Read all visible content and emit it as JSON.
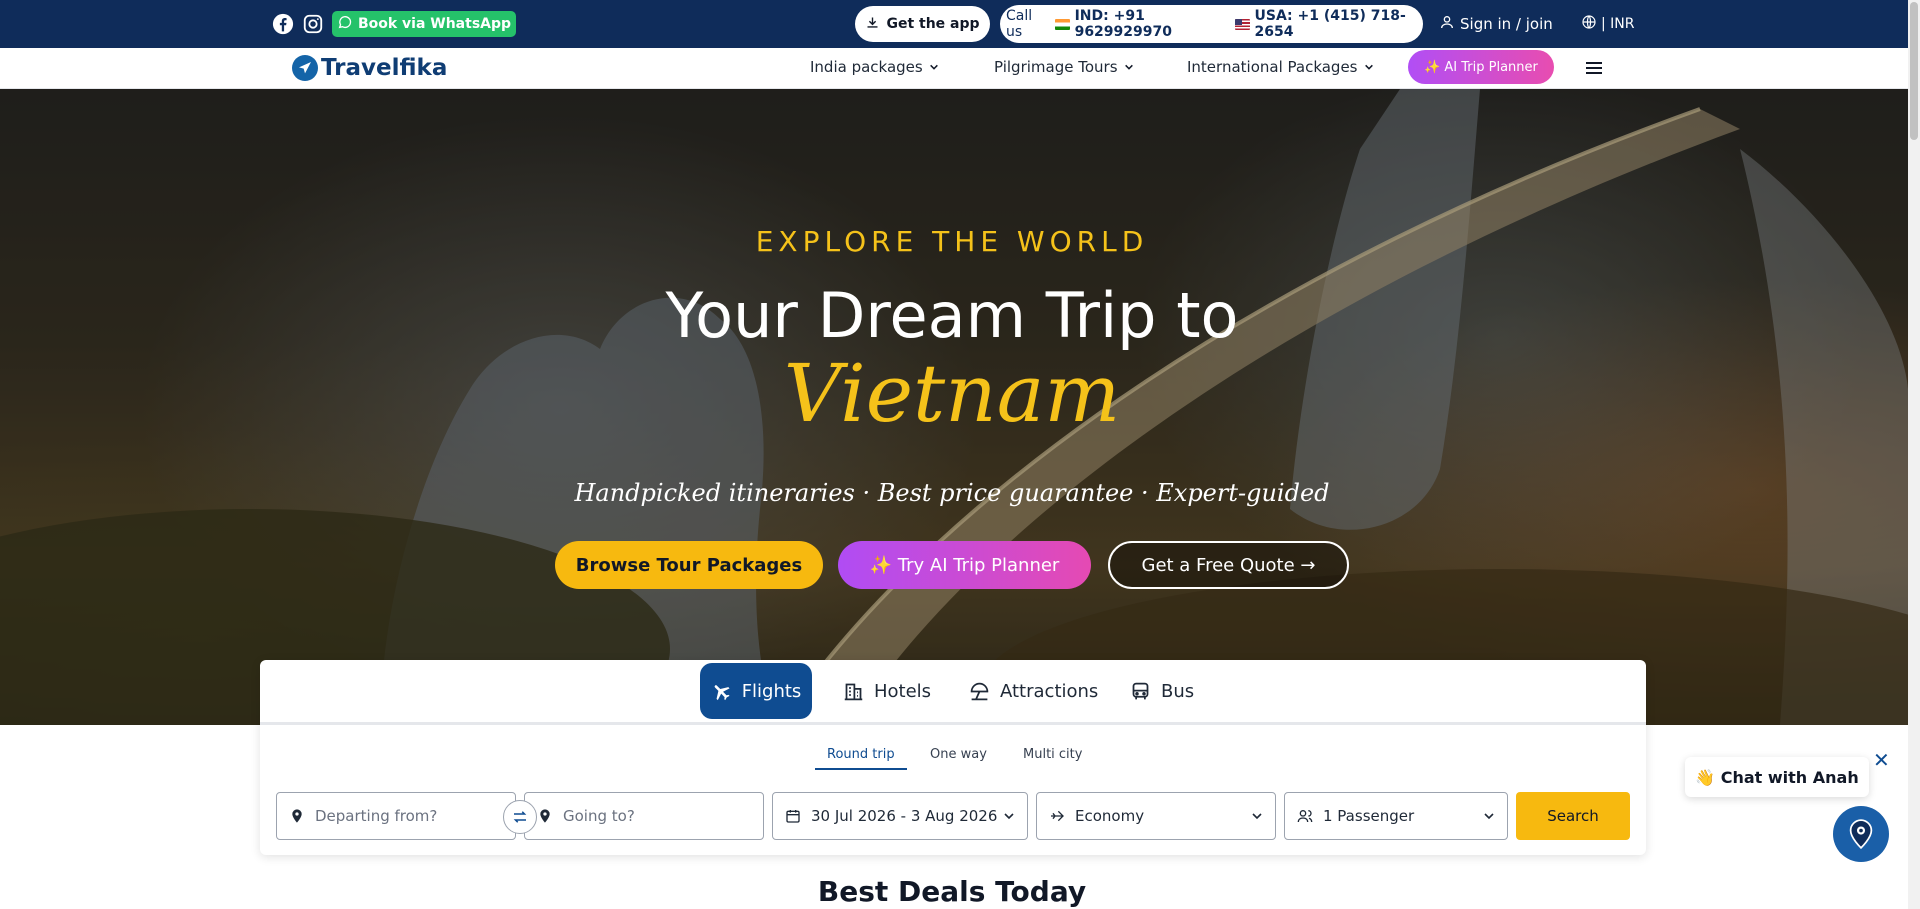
{
  "topbar": {
    "social": [
      "facebook-icon",
      "instagram-icon"
    ],
    "whatsapp_label": "Book via WhatsApp",
    "app_label": "Get the app",
    "call_label": "Call us",
    "ind_number": "IND: +91 9629929970",
    "usa_number": "USA: +1 (415) 718-2654",
    "signin_label": "Sign in / join",
    "currency_label": "| INR"
  },
  "nav": {
    "logo_text": "Travelfika",
    "items": [
      "India packages",
      "Pilgrimage Tours",
      "International Packages"
    ],
    "ai_label": "✨ AI Trip Planner"
  },
  "hero": {
    "eyebrow": "EXPLORE THE WORLD",
    "title": "Your Dream Trip to",
    "destination": "Vietnam",
    "tagline": "Handpicked itineraries · Best price guarantee · Expert-guided",
    "cta_browse": "Browse Tour Packages",
    "cta_ai": "✨ Try AI Trip Planner",
    "cta_quote": "Get a Free Quote →"
  },
  "search": {
    "tabs": [
      "Flights",
      "Hotels",
      "Attractions",
      "Bus"
    ],
    "active_tab": "Flights",
    "trip_types": [
      "Round trip",
      "One way",
      "Multi city"
    ],
    "active_trip_type": "Round trip",
    "from_placeholder": "Departing from?",
    "to_placeholder": "Going to?",
    "dates": "30 Jul 2026 - 3 Aug 2026",
    "cabin": "Economy",
    "passengers": "1 Passenger",
    "search_label": "Search"
  },
  "deals_title": "Best Deals Today",
  "chat": {
    "label": "👋 Chat with Anah",
    "close": "✕"
  },
  "colors": {
    "topbar_bg": "#0f2c5a",
    "accent_yellow": "#f7b90f",
    "accent_purple": "#b04cf4",
    "brand_blue": "#0f4c91",
    "whatsapp_green": "#25c26a"
  }
}
